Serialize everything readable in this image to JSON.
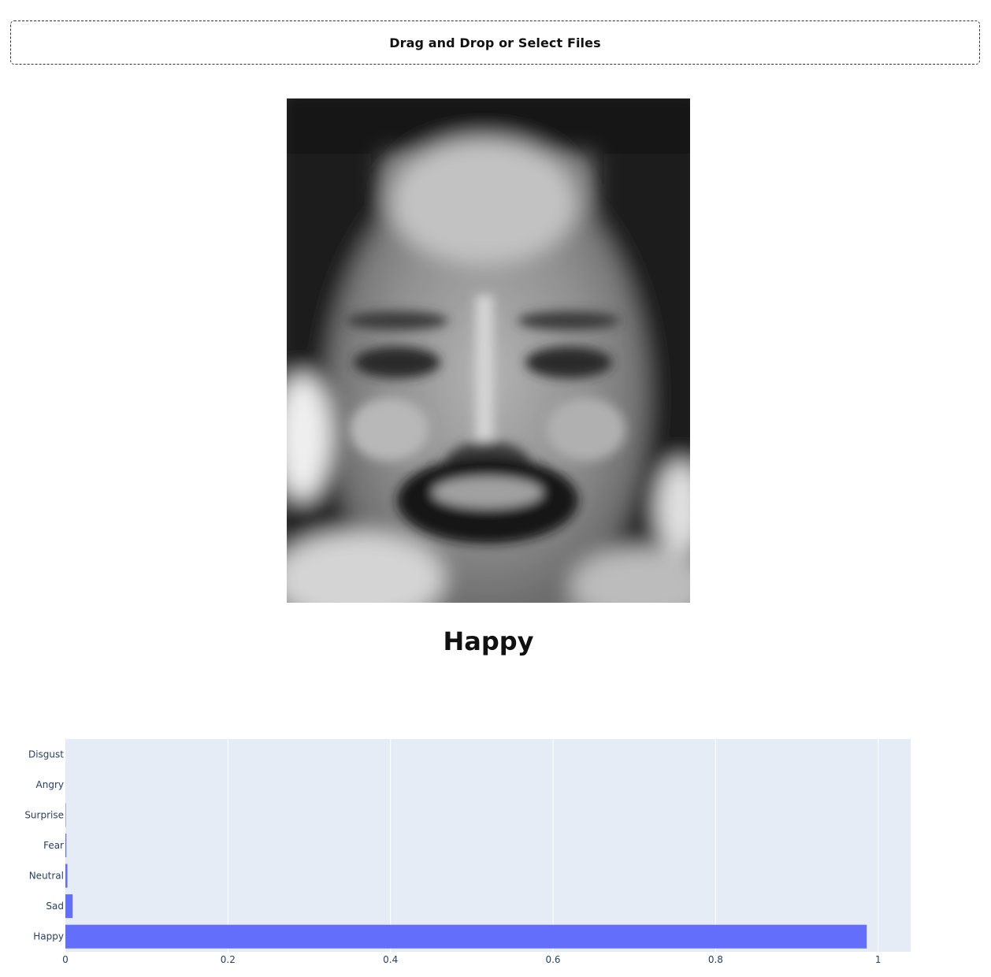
{
  "upload": {
    "label": "Drag and Drop or Select Files"
  },
  "image": {
    "alt": "grayscale face photo"
  },
  "prediction": {
    "label": "Happy"
  },
  "colors": {
    "bar": "#636efa",
    "plot_bg": "#e5ecf6",
    "grid": "#ffffff",
    "tick_text": "#2a3f5f"
  },
  "chart_data": {
    "type": "bar",
    "orientation": "horizontal",
    "categories": [
      "Disgust",
      "Angry",
      "Surprise",
      "Fear",
      "Neutral",
      "Sad",
      "Happy"
    ],
    "values": [
      0.0,
      0.0,
      0.0005,
      0.0012,
      0.0025,
      0.009,
      0.986
    ],
    "xlim": [
      0,
      1.04
    ],
    "xticks": [
      "0",
      "0.2",
      "0.4",
      "0.6",
      "0.8",
      "1"
    ],
    "xtick_values": [
      0,
      0.2,
      0.4,
      0.6,
      0.8,
      1
    ],
    "grid": true,
    "legend": "none"
  }
}
